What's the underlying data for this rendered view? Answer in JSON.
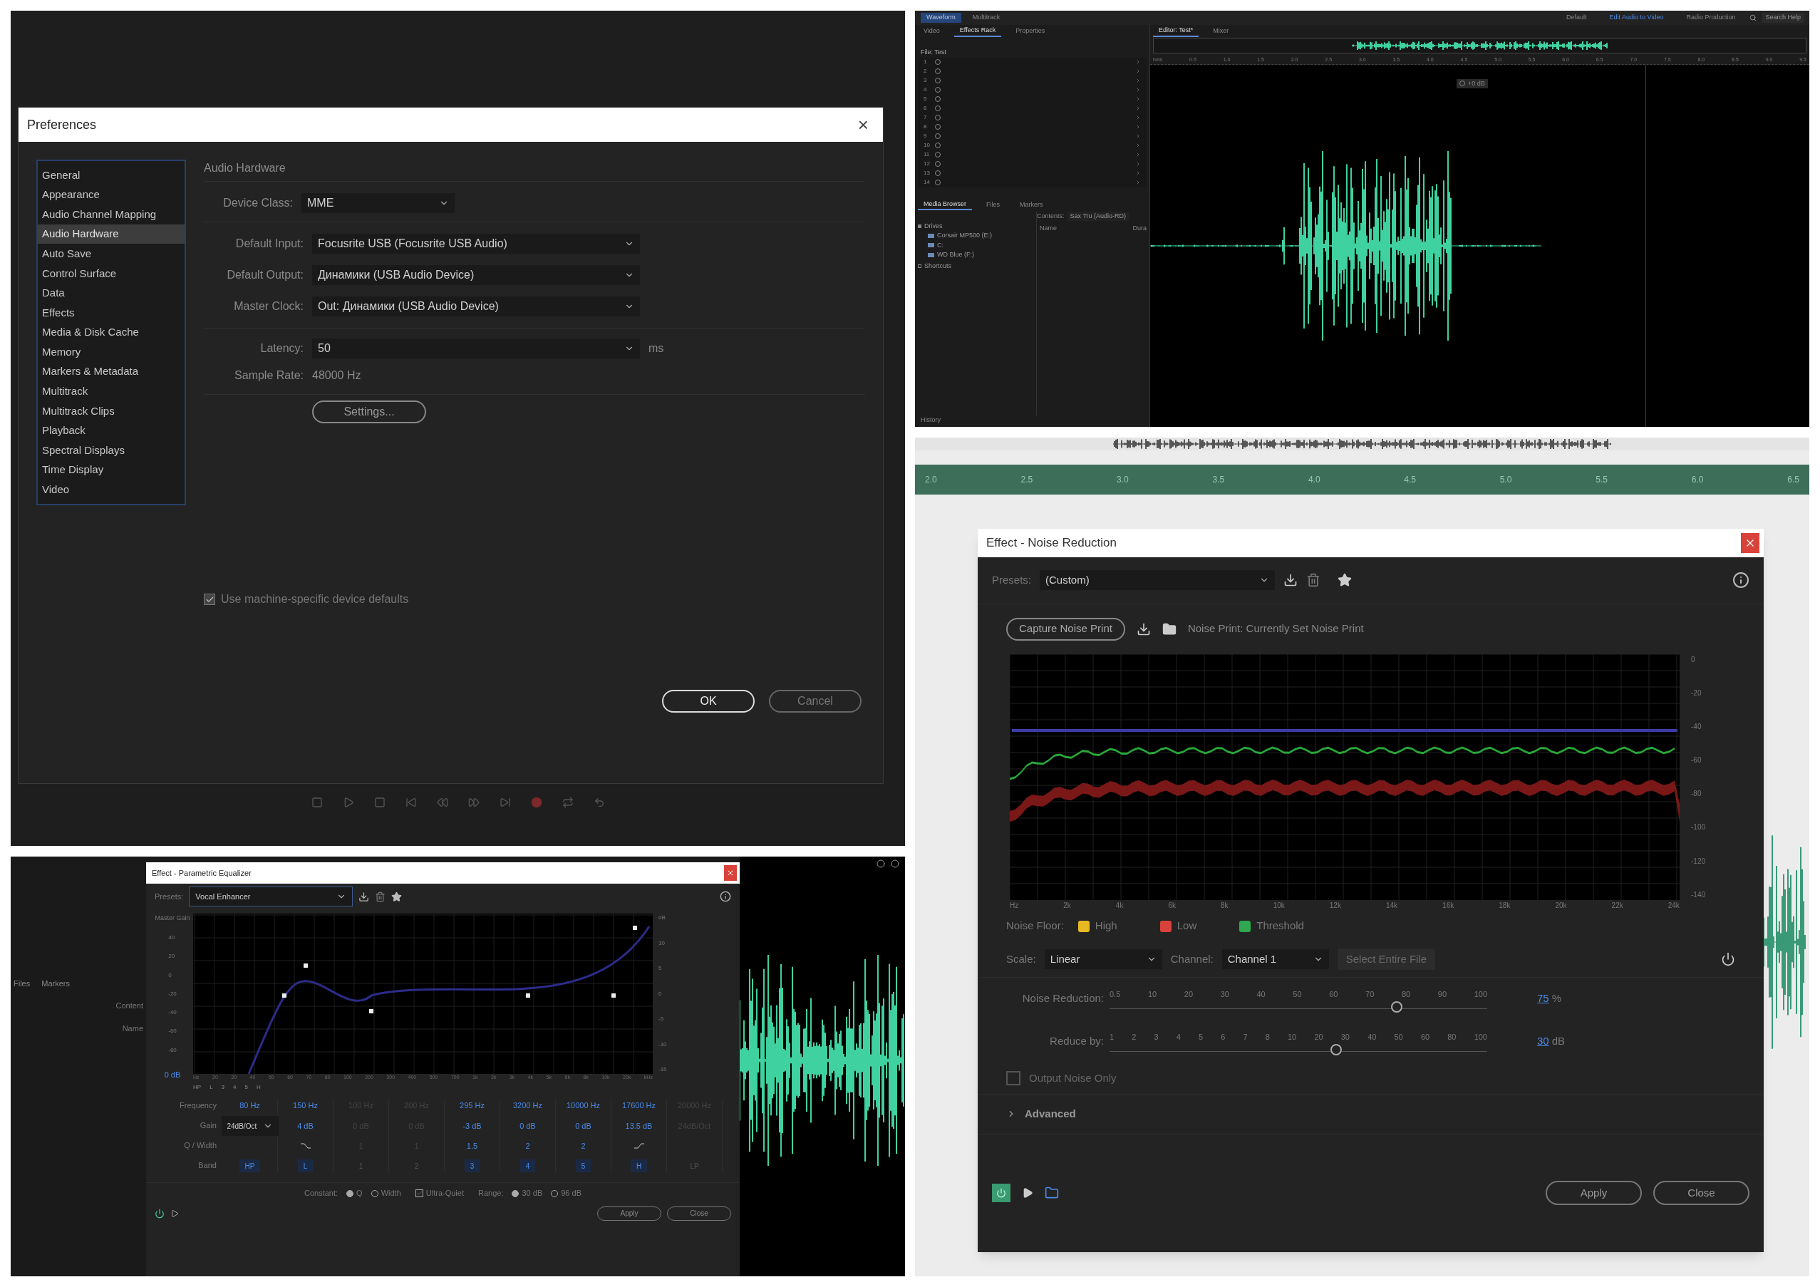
{
  "preferences_panel": {
    "dialog": {
      "title": "Preferences",
      "close": "×",
      "categories": [
        {
          "label": "General",
          "selected": false
        },
        {
          "label": "Appearance",
          "selected": false
        },
        {
          "label": "Audio Channel Mapping",
          "selected": false
        },
        {
          "label": "Audio Hardware",
          "selected": true
        },
        {
          "label": "Auto Save",
          "selected": false
        },
        {
          "label": "Control Surface",
          "selected": false
        },
        {
          "label": "Data",
          "selected": false
        },
        {
          "label": "Effects",
          "selected": false
        },
        {
          "label": "Media & Disk Cache",
          "selected": false
        },
        {
          "label": "Memory",
          "selected": false
        },
        {
          "label": "Markers & Metadata",
          "selected": false
        },
        {
          "label": "Multitrack",
          "selected": false
        },
        {
          "label": "Multitrack Clips",
          "selected": false
        },
        {
          "label": "Playback",
          "selected": false
        },
        {
          "label": "Spectral Displays",
          "selected": false
        },
        {
          "label": "Time Display",
          "selected": false
        },
        {
          "label": "Video",
          "selected": false
        }
      ],
      "section_title": "Audio Hardware",
      "device_class": {
        "label": "Device Class:",
        "value": "MME"
      },
      "fields": [
        {
          "label": "Default Input:",
          "value": "Focusrite USB (Focusrite USB Audio)"
        },
        {
          "label": "Default Output:",
          "value": "Динамики (USB Audio Device)"
        },
        {
          "label": "Master Clock:",
          "value": "Out: Динамики (USB Audio Device)"
        }
      ],
      "latency": {
        "label": "Latency:",
        "value": "50",
        "unit": "ms"
      },
      "sample_rate": {
        "label": "Sample Rate:",
        "value": "48000 Hz"
      },
      "settings_button": "Settings...",
      "defaults_checkbox": {
        "label": "Use machine-specific device defaults",
        "checked": true
      },
      "buttons": [
        "OK",
        "Cancel"
      ]
    }
  },
  "audition_window": {
    "workspace_tabs": [
      {
        "label": "Waveform",
        "selected": true
      },
      {
        "label": "Multitrack",
        "selected": false
      }
    ],
    "workspaces": [
      {
        "label": "Default",
        "selected": false
      },
      {
        "label": "Edit Audio to Video",
        "selected": true
      },
      {
        "label": "Radio Production",
        "selected": false
      }
    ],
    "search": "Search Help",
    "left_tabs": [
      {
        "label": "Video",
        "selected": false
      },
      {
        "label": "Effects Rack",
        "selected": true
      },
      {
        "label": "Properties",
        "selected": false
      }
    ],
    "rack_title": "File: Test",
    "rack_slots": [
      "1",
      "2",
      "3",
      "4",
      "5",
      "6",
      "7",
      "8",
      "9",
      "10",
      "11",
      "12",
      "13",
      "14"
    ],
    "browser_tabs": [
      {
        "label": "Media Browser",
        "selected": true
      },
      {
        "label": "Files",
        "selected": false
      },
      {
        "label": "Markers",
        "selected": false
      }
    ],
    "tree": [
      {
        "label": "Drives",
        "expanded": true,
        "children": [
          {
            "label": "Corsair MP500 (E:)"
          },
          {
            "label": "C:"
          },
          {
            "label": "WD Blue (F:)"
          }
        ]
      },
      {
        "label": "Shortcuts",
        "expanded": false
      }
    ],
    "contents_label": "Contents:",
    "contents_value": "Sax Tru (Audio-RD)",
    "columns": [
      "Name",
      "Dura"
    ],
    "history_tab": "History",
    "editor_tabs": [
      {
        "label": "Editor: Test*",
        "selected": true
      },
      {
        "label": "Mixer",
        "selected": false
      }
    ],
    "ruler": [
      "hms",
      "0.5",
      "1.0",
      "1.5",
      "2.0",
      "2.5",
      "3.0",
      "3.5",
      "4.0",
      "4.5",
      "5.0",
      "5.5",
      "6.0",
      "6.5",
      "7.0",
      "7.5",
      "8.0",
      "8.5",
      "9.0",
      "9.5"
    ],
    "hud_reading": "+0 dB"
  },
  "equalizer_panel": {
    "side_tabs": [
      "Files",
      "Markers"
    ],
    "side_labels": [
      "Content",
      "Name"
    ],
    "dialog": {
      "title": "Effect - Parametric Equalizer",
      "presets_label": "Presets:",
      "preset": "Vocal Enhancer",
      "master_gain": "Master Gain",
      "master_reading": "0 dB",
      "left_axis": [
        "40",
        "20",
        "0",
        "-20",
        "-40",
        "-60",
        "-80"
      ],
      "right_axis": [
        "dB",
        "10",
        "5",
        "0",
        "-5",
        "-10",
        "-15"
      ],
      "x_axis": [
        "Hz",
        "20",
        "30",
        "40",
        "50",
        "60",
        "70",
        "80",
        "100",
        "200",
        "300",
        "400",
        "500",
        "700",
        "1k",
        "2k",
        "3k",
        "4k",
        "5k",
        "6k",
        "8k",
        "10k",
        "20k",
        "kHz"
      ],
      "points": [
        "HP",
        "L",
        "3",
        "4",
        "5",
        "H"
      ],
      "row_labels": [
        "Frequency",
        "Gain",
        "Q / Width",
        "Band"
      ],
      "bands": [
        {
          "band": "HP",
          "frequency": "80 Hz",
          "gain": "24dB/Oct",
          "kind": "filter",
          "disabled": false
        },
        {
          "band": "L",
          "frequency": "150 Hz",
          "gain": "4 dB",
          "kind": "shelf_low",
          "disabled": false
        },
        {
          "band": "1",
          "frequency": "100 Hz",
          "gain": "0 dB",
          "q": "1",
          "kind": "peak",
          "disabled": true
        },
        {
          "band": "2",
          "frequency": "200 Hz",
          "gain": "0 dB",
          "q": "1",
          "kind": "peak",
          "disabled": true
        },
        {
          "band": "3",
          "frequency": "295 Hz",
          "gain": "-3 dB",
          "q": "1.5",
          "kind": "peak",
          "disabled": false
        },
        {
          "band": "4",
          "frequency": "3200 Hz",
          "gain": "0 dB",
          "q": "2",
          "kind": "peak",
          "disabled": false
        },
        {
          "band": "5",
          "frequency": "10000 Hz",
          "gain": "0 dB",
          "q": "2",
          "kind": "peak",
          "disabled": false
        },
        {
          "band": "H",
          "frequency": "17600 Hz",
          "gain": "13.5 dB",
          "kind": "shelf_high",
          "disabled": false
        },
        {
          "band": "LP",
          "frequency": "20000 Hz",
          "gain": "24dB/Oct",
          "kind": "filter",
          "disabled": true
        }
      ],
      "constant_label": "Constant:",
      "constant": [
        {
          "label": "Q",
          "selected": true
        },
        {
          "label": "Width",
          "selected": false
        }
      ],
      "ultra_quiet": {
        "label": "Ultra-Quiet",
        "checked": true
      },
      "range_label": "Range:",
      "range": [
        {
          "label": "30 dB",
          "selected": true
        },
        {
          "label": "96 dB",
          "selected": false
        }
      ],
      "buttons": [
        "Apply",
        "Close"
      ]
    }
  },
  "noise_reduction_panel": {
    "ruler": [
      "2.0",
      "2.5",
      "3.0",
      "3.5",
      "4.0",
      "4.5",
      "5.0",
      "5.5",
      "6.0",
      "6.5"
    ],
    "dialog": {
      "title": "Effect - Noise Reduction",
      "presets_label": "Presets:",
      "preset": "(Custom)",
      "capture_button": "Capture Noise Print",
      "noise_print": "Noise Print: Currently Set Noise Print",
      "y_axis": [
        "0",
        "-20",
        "-40",
        "-60",
        "-80",
        "-100",
        "-120",
        "-140"
      ],
      "x_axis": [
        "Hz",
        "2k",
        "4k",
        "6k",
        "8k",
        "10k",
        "12k",
        "14k",
        "16k",
        "18k",
        "20k",
        "22k",
        "24k"
      ],
      "legend_label": "Noise Floor:",
      "legend": [
        {
          "label": "High",
          "color": "#e8b923"
        },
        {
          "label": "Low",
          "color": "#d9423a"
        },
        {
          "label": "Threshold",
          "color": "#2fa84f"
        }
      ],
      "scale": {
        "label": "Scale:",
        "value": "Linear"
      },
      "channel": {
        "label": "Channel:",
        "value": "Channel 1"
      },
      "select_button": {
        "label": "Select Entire File",
        "disabled": true
      },
      "sliders": [
        {
          "label": "Noise Reduction:",
          "ticks": [
            "0.5",
            "10",
            "20",
            "30",
            "40",
            "50",
            "60",
            "70",
            "80",
            "90",
            "100"
          ],
          "level": 0.76,
          "reading": "75",
          "unit": "%"
        },
        {
          "label": "Reduce by:",
          "ticks": [
            "1",
            "2",
            "3",
            "4",
            "5",
            "6",
            "7",
            "8",
            "10",
            "20",
            "30",
            "40",
            "50",
            "60",
            "80",
            "100"
          ],
          "level": 0.6,
          "reading": "30",
          "unit": "dB"
        }
      ],
      "output_noise_only": {
        "label": "Output Noise Only",
        "checked": false
      },
      "advanced": {
        "label": "Advanced",
        "expanded": false
      },
      "buttons": [
        "Apply",
        "Close"
      ]
    }
  }
}
